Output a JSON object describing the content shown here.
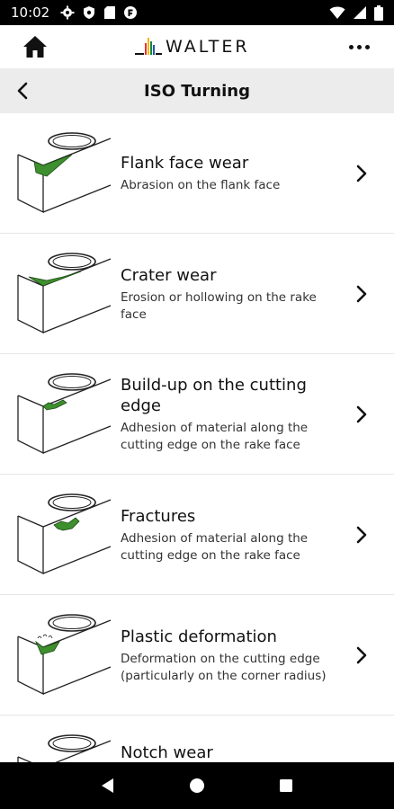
{
  "status_bar": {
    "time": "10:02",
    "icons_left": [
      "settings-icon",
      "shield-icon",
      "sd-card-icon",
      "app-notification-icon"
    ],
    "icons_right": [
      "wifi-icon",
      "signal-icon",
      "battery-icon"
    ]
  },
  "header": {
    "logo_text": "WALTER",
    "home_icon": "home-icon",
    "more_icon": "more-options-icon",
    "logo_colors": [
      "#e5332a",
      "#f7b500",
      "#0f8a3c",
      "#1f57a5"
    ]
  },
  "sub_header": {
    "title": "ISO Turning",
    "back_icon": "chevron-left-icon"
  },
  "list": {
    "items": [
      {
        "title": "Flank face wear",
        "description": "Abrasion on the flank face",
        "thumb_icon": "flank-face-wear-icon"
      },
      {
        "title": "Crater wear",
        "description": "Erosion or hollowing on the rake face",
        "thumb_icon": "crater-wear-icon"
      },
      {
        "title": "Build-up on the cutting edge",
        "description": "Adhesion of material along the cutting edge on the rake face",
        "thumb_icon": "build-up-edge-icon"
      },
      {
        "title": "Fractures",
        "description": "Adhesion of material along the cutting edge on the rake face",
        "thumb_icon": "fractures-icon"
      },
      {
        "title": "Plastic deformation",
        "description": "Deformation on the cutting edge (particularly on the corner radius)",
        "thumb_icon": "plastic-deformation-icon"
      },
      {
        "title": "Notch wear",
        "description": "",
        "thumb_icon": "notch-wear-icon"
      }
    ]
  },
  "colors": {
    "wear_green": "#3e8f2e",
    "sub_header_bg": "#ececec",
    "status_bg": "#000000"
  },
  "nav_bar": {
    "back_icon": "triangle-back-icon",
    "home_icon": "circle-home-icon",
    "recents_icon": "square-recents-icon"
  }
}
